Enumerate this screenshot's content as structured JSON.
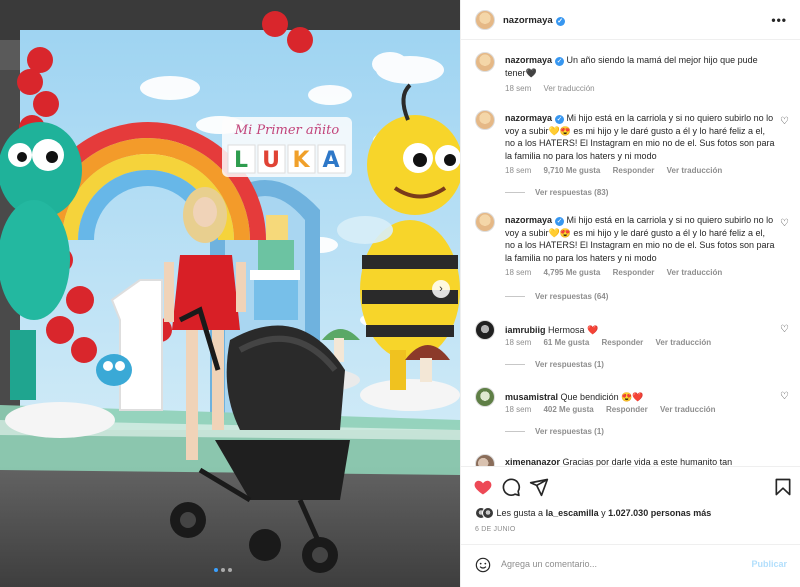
{
  "photo": {
    "sign_script": "Mi Primer añito",
    "sign_letters": [
      "L",
      "U",
      "K",
      "A"
    ],
    "number": "1"
  },
  "header": {
    "username": "nazormaya",
    "more_label": "•••"
  },
  "comments": [
    {
      "username": "nazormaya",
      "text": "Un año siendo la mamá del mejor hijo que pude tener🖤",
      "time": "18 sem",
      "translate": "Ver traducción"
    },
    {
      "username": "nazormaya",
      "text": "Mi hijo está en la carriola y si no quiero subirlo no lo voy a subir💛😍 es mi hijo y le daré gusto a él y lo haré feliz a el, no a los HATERS! El Instagram en mio no de el. Sus fotos son para la familia no para los haters y ni modo",
      "time": "18 sem",
      "likes": "9,710 Me gusta",
      "reply": "Responder",
      "translate": "Ver traducción",
      "replies": "Ver respuestas (83)"
    },
    {
      "username": "nazormaya",
      "text": "Mi hijo está en la carriola y si no quiero subirlo no lo voy a subir💛😍 es mi hijo y le daré gusto a él y lo haré feliz a el, no a los HATERS! El Instagram en mio no de el. Sus fotos son para la familia no para los haters y ni modo",
      "time": "18 sem",
      "likes": "4,795 Me gusta",
      "reply": "Responder",
      "translate": "Ver traducción",
      "replies": "Ver respuestas (64)"
    },
    {
      "username": "iamrubiig",
      "text": "Hermosa ❤️",
      "time": "18 sem",
      "likes": "61 Me gusta",
      "reply": "Responder",
      "translate": "Ver traducción",
      "replies": "Ver respuestas (1)"
    },
    {
      "username": "musamistral",
      "text": "Que bendición 😍❤️",
      "time": "18 sem",
      "likes": "402 Me gusta",
      "reply": "Responder",
      "translate": "Ver traducción",
      "replies": "Ver respuestas (1)"
    },
    {
      "username": "ximenanazor",
      "text": "Gracias por darle vida a este humanito tan"
    }
  ],
  "likes_line": {
    "prefix": "Les gusta a",
    "user": "la_escamilla",
    "mid": "y",
    "count": "1.027.030 personas más"
  },
  "date": "6 DE JUNIO",
  "comment_box": {
    "placeholder": "Agrega un comentario...",
    "post_label": "Publicar"
  },
  "colors": {
    "accent": "#3897f0",
    "like_red": "#ed4956",
    "post_disabled": "#b2dffc"
  },
  "icons": [
    "heart-icon",
    "comment-icon",
    "share-icon",
    "bookmark-icon",
    "smile-icon",
    "verified-icon",
    "heart-small-icon",
    "more-icon"
  ]
}
